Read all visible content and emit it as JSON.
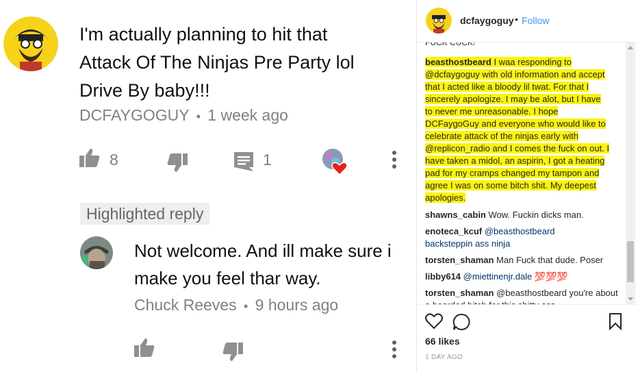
{
  "youtube": {
    "comment": {
      "text": "I'm actually planning to hit that Attack Of The Ninjas Pre Party lol Drive By baby!!!",
      "author": "DCFAYGOGUY",
      "separator": "•",
      "time": "1 week ago",
      "likes": "8",
      "replies": "1"
    },
    "highlighted_label": "Highlighted reply",
    "reply": {
      "text": "Not welcome. And ill make sure i make you feel thar way.",
      "author": "Chuck Reeves",
      "separator": "•",
      "time": "9 hours ago"
    }
  },
  "instagram": {
    "username": "dcfaygoguy",
    "dot": "•",
    "follow": "Follow",
    "cut_top": "FUCK CUCK!",
    "comments": [
      {
        "user": "beasthostbeard",
        "text": "I waa responding to @dcfaygoguy with old information and accept that I acted like a bloody lil twat. For that I sincerely apologize. I may be alot, but I have to never me unreasonable. I hope DCFaygoGuy and everyone who would like to celebrate attack of the ninjas early with @replicon_radio and I comes the fuck on out. I have taken a midol, an aspirin, I got a heating pad for my cramps changed my tampon and agree I was on some bitch shit. My deepest apologies."
      },
      {
        "user": "shawns_cabin",
        "text": "Wow. Fuckin dicks man."
      },
      {
        "user": "enoteca_kcuf",
        "text": "@beasthostbeard backsteppin ass ninja"
      },
      {
        "user": "torsten_shaman",
        "text": "Man Fuck that dude. Poser"
      },
      {
        "user": "libby614",
        "text": "@miettinenjr.dale 💯💯💯"
      },
      {
        "user": "torsten_shaman",
        "text": "@beasthostbeard you're about a bearded bitch for this shitty ass"
      }
    ],
    "likes": "66 likes",
    "time_ago": "1 DAY AGO"
  },
  "colors": {
    "highlight": "#fbf30f",
    "link": "#3897f0",
    "mention": "#003569",
    "meta": "#808080"
  }
}
